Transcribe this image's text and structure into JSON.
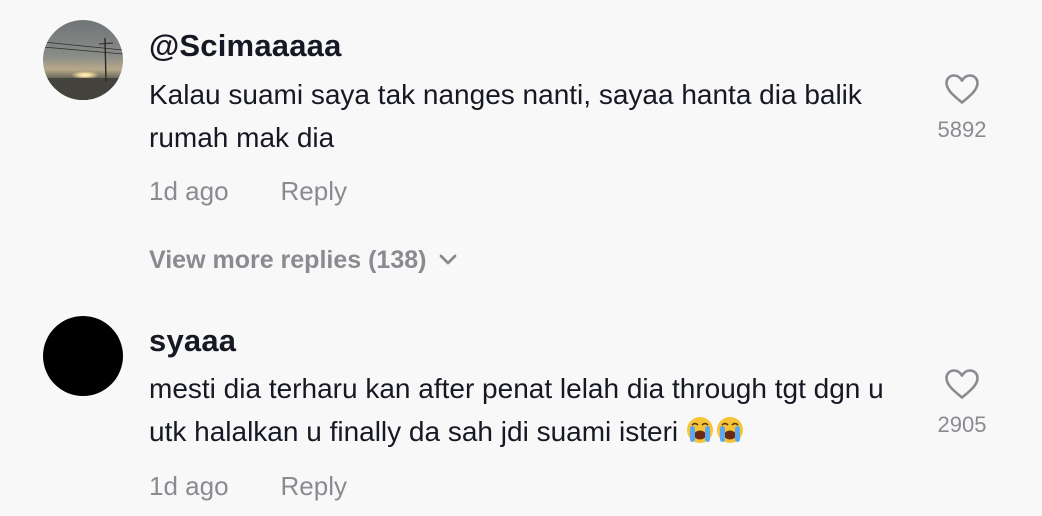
{
  "comments": [
    {
      "username": "@Scimaaaaa",
      "text": "Kalau suami saya tak nanges nanti, sayaa hanta dia balik rumah mak dia",
      "time": "1d ago",
      "reply_label": "Reply",
      "likes": "5892",
      "avatar_icon": "sunset-photo-avatar"
    },
    {
      "username": "syaaa",
      "text": "mesti dia terharu kan after penat lelah dia through tgt dgn u utk halalkan u finally da sah jdi suami isteri",
      "emoji": "😭😭",
      "time": "1d ago",
      "reply_label": "Reply",
      "likes": "2905",
      "avatar_color": "#000000"
    }
  ],
  "view_more_replies": "View more replies (138)",
  "colors": {
    "background": "#f8f8f8",
    "text": "#161823",
    "muted": "#8a8b91"
  },
  "icons": {
    "like": "heart-outline-icon",
    "expand": "chevron-down-icon",
    "emoji": "loudly-crying-face-emoji"
  }
}
